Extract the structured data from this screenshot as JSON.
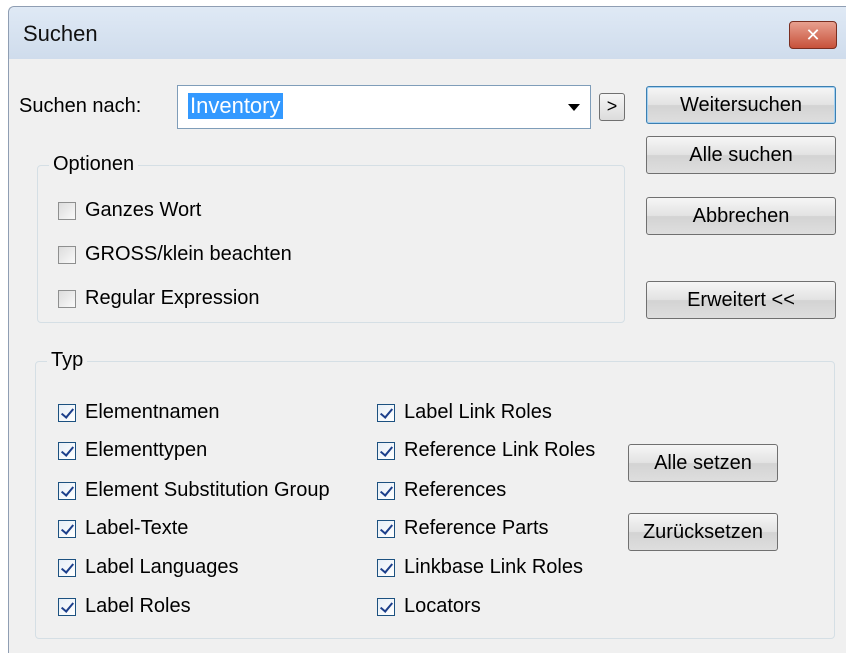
{
  "window": {
    "title": "Suchen",
    "close_glyph": "✕"
  },
  "search": {
    "label": "Suchen nach:",
    "value": "Inventory",
    "more_button": ">"
  },
  "buttons": {
    "find_next": "Weitersuchen",
    "find_all": "Alle suchen",
    "cancel": "Abbrechen",
    "advanced": "Erweitert <<",
    "set_all": "Alle setzen",
    "reset": "Zurücksetzen"
  },
  "options": {
    "legend": "Optionen",
    "items": [
      {
        "label": "Ganzes Wort",
        "checked": false
      },
      {
        "label": "GROSS/klein beachten",
        "checked": false
      },
      {
        "label": "Regular Expression",
        "checked": false
      }
    ]
  },
  "type": {
    "legend": "Typ",
    "left": [
      {
        "label": "Elementnamen",
        "checked": true
      },
      {
        "label": "Elementtypen",
        "checked": true
      },
      {
        "label": "Element Substitution Group",
        "checked": true
      },
      {
        "label": "Label-Texte",
        "checked": true
      },
      {
        "label": "Label Languages",
        "checked": true
      },
      {
        "label": "Label Roles",
        "checked": true
      }
    ],
    "right": [
      {
        "label": "Label Link Roles",
        "checked": true
      },
      {
        "label": "Reference Link Roles",
        "checked": true
      },
      {
        "label": "References",
        "checked": true
      },
      {
        "label": "Reference Parts",
        "checked": true
      },
      {
        "label": "Linkbase Link Roles",
        "checked": true
      },
      {
        "label": "Locators",
        "checked": true
      }
    ]
  }
}
